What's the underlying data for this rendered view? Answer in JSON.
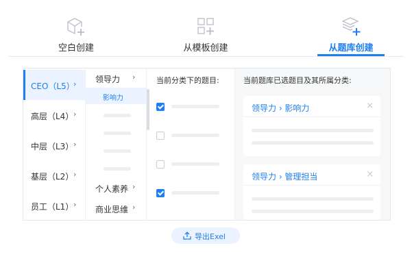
{
  "tabs": [
    {
      "label": "空白创建",
      "icon": "cube-plus-icon",
      "active": false
    },
    {
      "label": "从模板创建",
      "icon": "grid-plus-icon",
      "active": false
    },
    {
      "label": "从题库创建",
      "icon": "stack-plus-icon",
      "active": true
    }
  ],
  "levels": [
    {
      "label": "CEO（L5）",
      "chevron": "›"
    },
    {
      "label": "高层（L4）",
      "chevron": "›"
    },
    {
      "label": "中层（L3）",
      "chevron": "›"
    },
    {
      "label": "基层（L2）",
      "chevron": "›"
    },
    {
      "label": "员工（L1）",
      "chevron": "›"
    }
  ],
  "categories": {
    "top": {
      "label": "领导力",
      "chevron": "›"
    },
    "sub_selected": "影响力",
    "bottom": [
      {
        "label": "个人素养",
        "chevron": "›"
      },
      {
        "label": "商业思维",
        "chevron": "›"
      }
    ]
  },
  "questions": {
    "header": "当前分类下的题目:",
    "checked": [
      true,
      false,
      false,
      true
    ]
  },
  "selected": {
    "header": "当前题库已选题目及其所属分类:",
    "cards": [
      {
        "title": "领导力 › 影响力",
        "close": "×"
      },
      {
        "title": "领导力 › 管理担当",
        "close": "×"
      }
    ]
  },
  "export": {
    "label": "导出Exel",
    "icon": "export-icon"
  },
  "colors": {
    "accent": "#1f7ff0",
    "accent_bg": "#eaf3ff",
    "skeleton": "#eceef1"
  }
}
